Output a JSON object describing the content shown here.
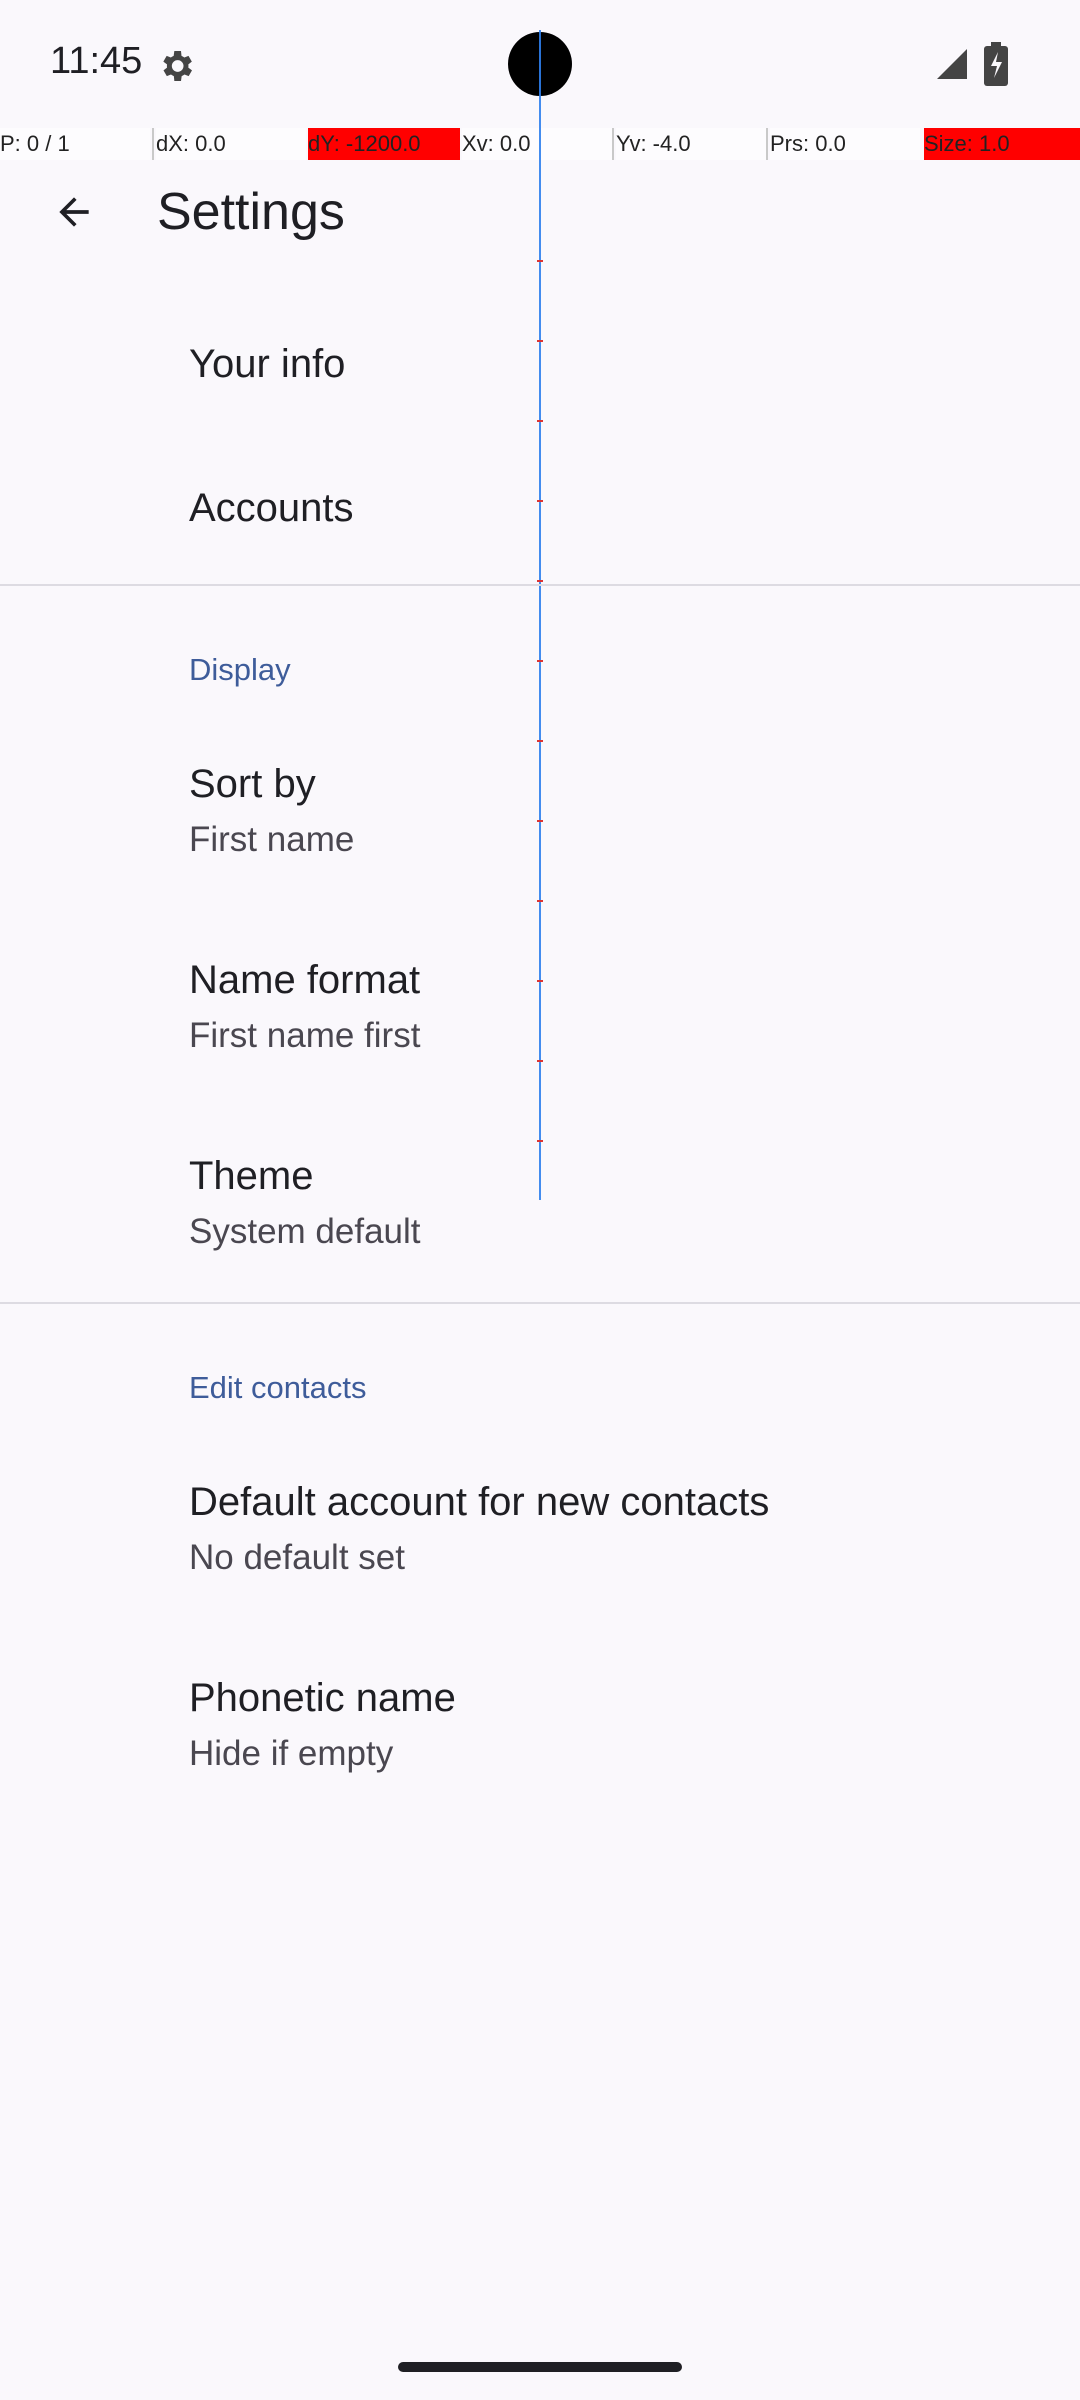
{
  "status_bar": {
    "time": "11:45",
    "icons": [
      "settings-gear-icon",
      "cellular-signal-icon",
      "battery-icon"
    ]
  },
  "pointer_overlay": {
    "p": "P: 0 / 1",
    "dx": "dX: 0.0",
    "dy": "dY: -1200.0",
    "xv": "Xv: 0.0",
    "yv": "Yv: -4.0",
    "prs": "Prs: 0.0",
    "size": "Size: 1.0"
  },
  "app_bar": {
    "title": "Settings",
    "back_icon": "arrow-back-icon"
  },
  "top_items": {
    "your_info": "Your info",
    "accounts": "Accounts"
  },
  "display_section": {
    "header": "Display",
    "sort_by": {
      "title": "Sort by",
      "summary": "First name"
    },
    "name_format": {
      "title": "Name format",
      "summary": "First name first"
    },
    "theme": {
      "title": "Theme",
      "summary": "System default"
    }
  },
  "edit_contacts_section": {
    "header": "Edit contacts",
    "default_account": {
      "title": "Default account for new contacts",
      "summary": "No default set"
    },
    "phonetic_name": {
      "title": "Phonetic name",
      "summary": "Hide if empty"
    }
  },
  "colors": {
    "background": "#FAF8FC",
    "section_header": "#3E5C9A",
    "overlay_highlight": "#FF0000",
    "crosshair": "#2F80ED"
  }
}
